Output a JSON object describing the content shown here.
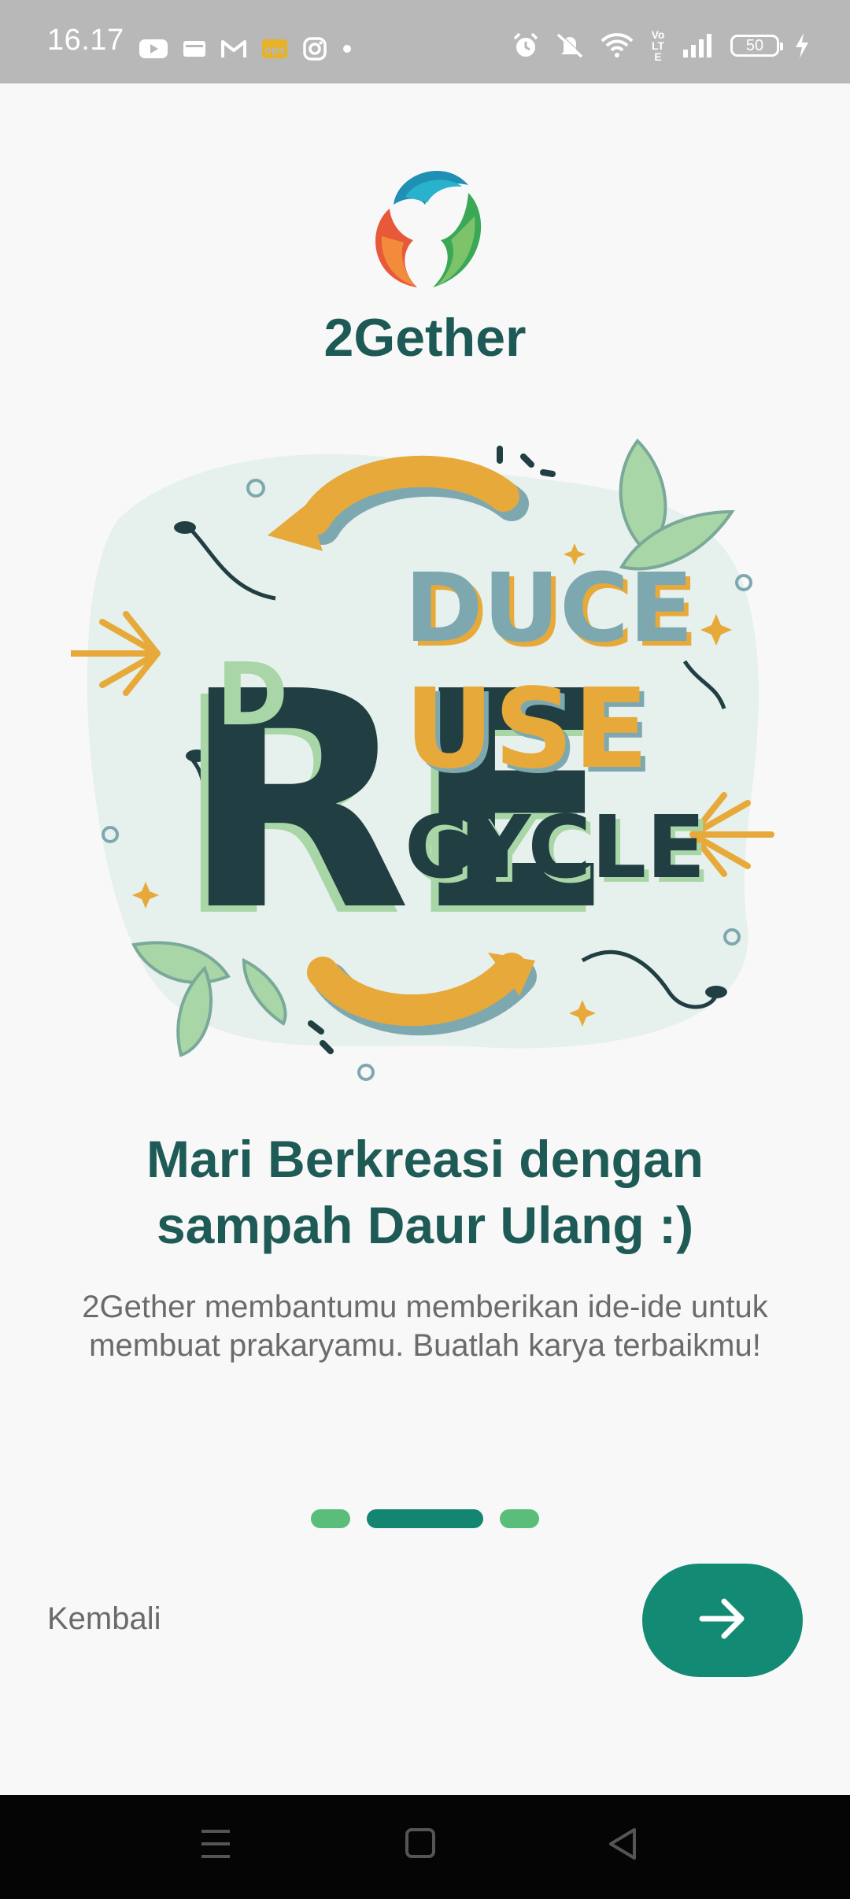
{
  "status_bar": {
    "time": "16.17",
    "left_icons": [
      "youtube-icon",
      "message-icon",
      "gmail-icon",
      "app-notification-icon",
      "instagram-icon",
      "dot-icon"
    ],
    "right_icons": [
      "alarm-icon",
      "mute-icon",
      "wifi-icon",
      "volte-icon",
      "signal-icon",
      "battery-icon",
      "charging-icon"
    ],
    "volte_label": "Vo LTE",
    "battery_level": "50"
  },
  "app": {
    "name": "2Gether"
  },
  "onboarding": {
    "headline": "Mari Berkreasi dengan sampah Daur Ulang :)",
    "subtitle": "2Gether membantumu memberikan ide-ide untuk membuat prakaryamu. Buatlah karya terbaikmu!",
    "illustration_words": {
      "re": "RE",
      "duce": "DUCE",
      "use": "USE",
      "cycle": "CYCLE",
      "d": "D"
    },
    "page_indicator": {
      "current": 2,
      "total": 3
    },
    "back_label": "Kembali",
    "next_icon": "arrow-right-icon"
  },
  "nav_bar": {
    "icons": [
      "menu-icon",
      "home-icon",
      "back-icon"
    ]
  },
  "colors": {
    "primary": "#138a73",
    "title": "#1d5a55",
    "dot_inactive": "#5bbd7a",
    "illustration_orange": "#e7a93a",
    "illustration_teal": "#7ea8b0",
    "illustration_dark": "#213f42",
    "illustration_green": "#a9d6a6"
  }
}
